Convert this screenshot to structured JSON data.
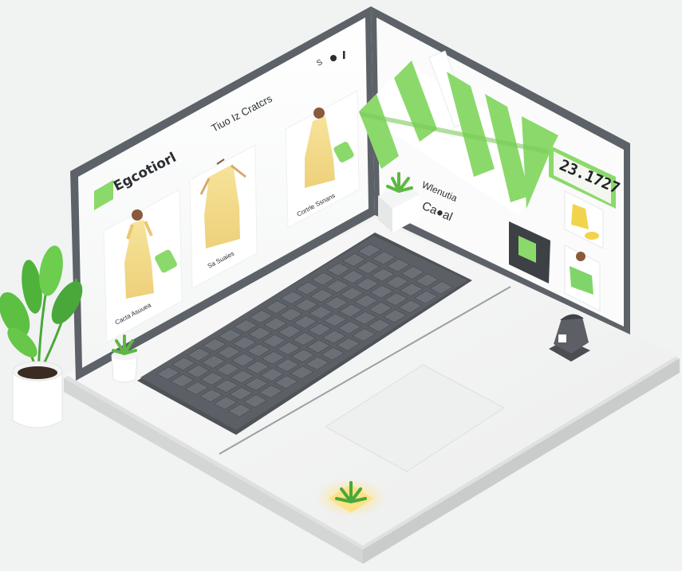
{
  "screen_left": {
    "brand": "Egcotiorl",
    "heading": "Tiuo Iz Cratcrs",
    "top_icons": [
      "search-icon",
      "dot-icon",
      "kebab-icon"
    ],
    "products": [
      {
        "caption": "Cacta Asuuea",
        "image": "yellow-dress-figure",
        "badge": "tag-icon"
      },
      {
        "caption": "Sa Suaies",
        "image": "yellow-dress-on-hanger"
      },
      {
        "caption": "Cortrle Ssnans",
        "image": "yellow-dress-figure",
        "badge": "tag-icon"
      }
    ]
  },
  "screen_right": {
    "title": "Wlenutia",
    "subtitle": "Ca●al",
    "price": "23.1727",
    "awning_colors": [
      "#8bd96b",
      "#ffffff"
    ],
    "items": [
      "yellow-shoes-thumbnail",
      "green-sweater-thumbnail",
      "dark-shirt-thumbnail"
    ]
  },
  "accent_color": "#8bd96b",
  "keyboard_color": "#5c6066"
}
